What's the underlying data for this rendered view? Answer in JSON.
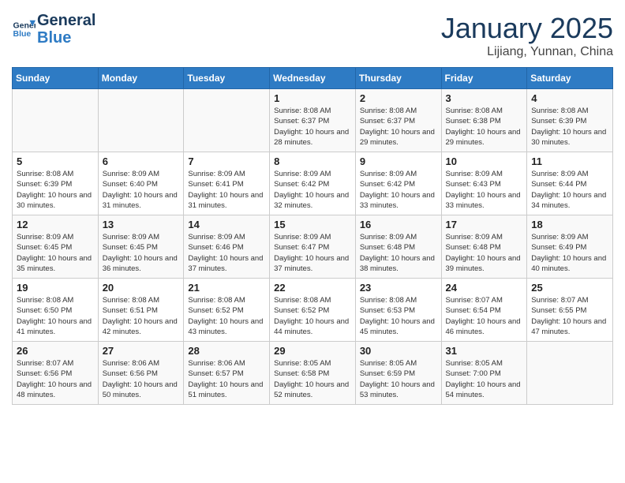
{
  "header": {
    "logo_line1": "General",
    "logo_line2": "Blue",
    "month": "January 2025",
    "location": "Lijiang, Yunnan, China"
  },
  "days_of_week": [
    "Sunday",
    "Monday",
    "Tuesday",
    "Wednesday",
    "Thursday",
    "Friday",
    "Saturday"
  ],
  "weeks": [
    [
      {
        "day": "",
        "empty": true
      },
      {
        "day": "",
        "empty": true
      },
      {
        "day": "",
        "empty": true
      },
      {
        "day": "1",
        "sunrise": "8:08 AM",
        "sunset": "6:37 PM",
        "daylight": "10 hours and 28 minutes."
      },
      {
        "day": "2",
        "sunrise": "8:08 AM",
        "sunset": "6:37 PM",
        "daylight": "10 hours and 29 minutes."
      },
      {
        "day": "3",
        "sunrise": "8:08 AM",
        "sunset": "6:38 PM",
        "daylight": "10 hours and 29 minutes."
      },
      {
        "day": "4",
        "sunrise": "8:08 AM",
        "sunset": "6:39 PM",
        "daylight": "10 hours and 30 minutes."
      }
    ],
    [
      {
        "day": "5",
        "sunrise": "8:08 AM",
        "sunset": "6:39 PM",
        "daylight": "10 hours and 30 minutes."
      },
      {
        "day": "6",
        "sunrise": "8:09 AM",
        "sunset": "6:40 PM",
        "daylight": "10 hours and 31 minutes."
      },
      {
        "day": "7",
        "sunrise": "8:09 AM",
        "sunset": "6:41 PM",
        "daylight": "10 hours and 31 minutes."
      },
      {
        "day": "8",
        "sunrise": "8:09 AM",
        "sunset": "6:42 PM",
        "daylight": "10 hours and 32 minutes."
      },
      {
        "day": "9",
        "sunrise": "8:09 AM",
        "sunset": "6:42 PM",
        "daylight": "10 hours and 33 minutes."
      },
      {
        "day": "10",
        "sunrise": "8:09 AM",
        "sunset": "6:43 PM",
        "daylight": "10 hours and 33 minutes."
      },
      {
        "day": "11",
        "sunrise": "8:09 AM",
        "sunset": "6:44 PM",
        "daylight": "10 hours and 34 minutes."
      }
    ],
    [
      {
        "day": "12",
        "sunrise": "8:09 AM",
        "sunset": "6:45 PM",
        "daylight": "10 hours and 35 minutes."
      },
      {
        "day": "13",
        "sunrise": "8:09 AM",
        "sunset": "6:45 PM",
        "daylight": "10 hours and 36 minutes."
      },
      {
        "day": "14",
        "sunrise": "8:09 AM",
        "sunset": "6:46 PM",
        "daylight": "10 hours and 37 minutes."
      },
      {
        "day": "15",
        "sunrise": "8:09 AM",
        "sunset": "6:47 PM",
        "daylight": "10 hours and 37 minutes."
      },
      {
        "day": "16",
        "sunrise": "8:09 AM",
        "sunset": "6:48 PM",
        "daylight": "10 hours and 38 minutes."
      },
      {
        "day": "17",
        "sunrise": "8:09 AM",
        "sunset": "6:48 PM",
        "daylight": "10 hours and 39 minutes."
      },
      {
        "day": "18",
        "sunrise": "8:09 AM",
        "sunset": "6:49 PM",
        "daylight": "10 hours and 40 minutes."
      }
    ],
    [
      {
        "day": "19",
        "sunrise": "8:08 AM",
        "sunset": "6:50 PM",
        "daylight": "10 hours and 41 minutes."
      },
      {
        "day": "20",
        "sunrise": "8:08 AM",
        "sunset": "6:51 PM",
        "daylight": "10 hours and 42 minutes."
      },
      {
        "day": "21",
        "sunrise": "8:08 AM",
        "sunset": "6:52 PM",
        "daylight": "10 hours and 43 minutes."
      },
      {
        "day": "22",
        "sunrise": "8:08 AM",
        "sunset": "6:52 PM",
        "daylight": "10 hours and 44 minutes."
      },
      {
        "day": "23",
        "sunrise": "8:08 AM",
        "sunset": "6:53 PM",
        "daylight": "10 hours and 45 minutes."
      },
      {
        "day": "24",
        "sunrise": "8:07 AM",
        "sunset": "6:54 PM",
        "daylight": "10 hours and 46 minutes."
      },
      {
        "day": "25",
        "sunrise": "8:07 AM",
        "sunset": "6:55 PM",
        "daylight": "10 hours and 47 minutes."
      }
    ],
    [
      {
        "day": "26",
        "sunrise": "8:07 AM",
        "sunset": "6:56 PM",
        "daylight": "10 hours and 48 minutes."
      },
      {
        "day": "27",
        "sunrise": "8:06 AM",
        "sunset": "6:56 PM",
        "daylight": "10 hours and 50 minutes."
      },
      {
        "day": "28",
        "sunrise": "8:06 AM",
        "sunset": "6:57 PM",
        "daylight": "10 hours and 51 minutes."
      },
      {
        "day": "29",
        "sunrise": "8:05 AM",
        "sunset": "6:58 PM",
        "daylight": "10 hours and 52 minutes."
      },
      {
        "day": "30",
        "sunrise": "8:05 AM",
        "sunset": "6:59 PM",
        "daylight": "10 hours and 53 minutes."
      },
      {
        "day": "31",
        "sunrise": "8:05 AM",
        "sunset": "7:00 PM",
        "daylight": "10 hours and 54 minutes."
      },
      {
        "day": "",
        "empty": true
      }
    ]
  ]
}
